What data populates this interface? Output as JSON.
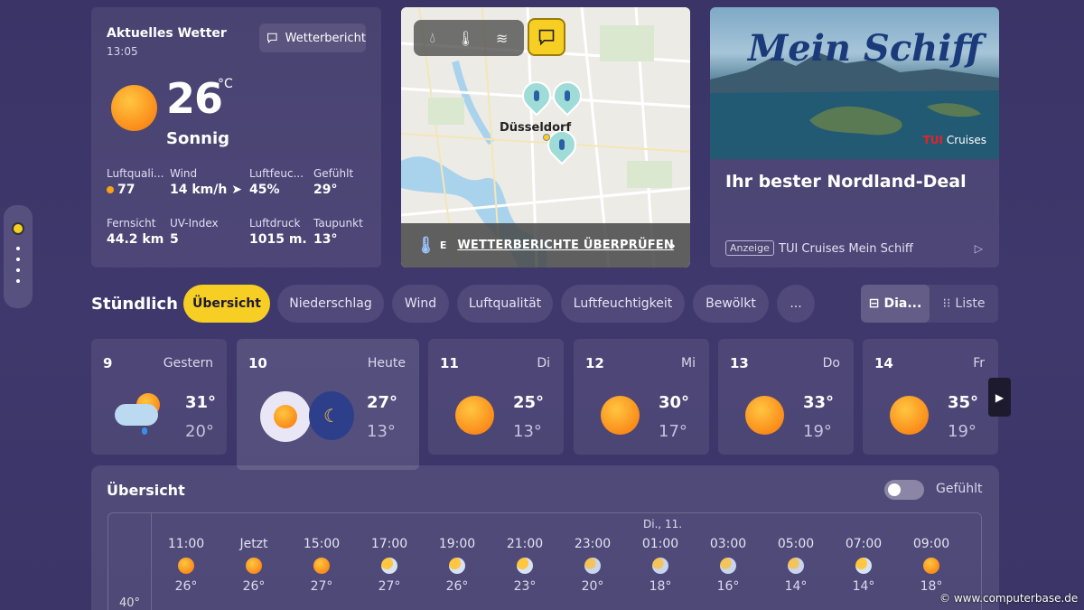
{
  "current": {
    "title": "Aktuelles Wetter",
    "time": "13:05",
    "report_btn": "Wetterbericht",
    "temp": "26",
    "unit": "°C",
    "condition": "Sonnig",
    "stats": [
      {
        "label": "Luftquali...",
        "value": "77"
      },
      {
        "label": "Wind",
        "value": "14 km/h"
      },
      {
        "label": "Luftfeuc...",
        "value": "45%"
      },
      {
        "label": "Gefühlt",
        "value": "29°"
      },
      {
        "label": "Fernsicht",
        "value": "44.2 km"
      },
      {
        "label": "UV-Index",
        "value": "5"
      },
      {
        "label": "Luftdruck",
        "value": "1015 m..."
      },
      {
        "label": "Taupunkt",
        "value": "13°"
      }
    ],
    "colors": {
      "sun": "#fb8c1a",
      "aqi_dot": "#f7a21b"
    }
  },
  "map": {
    "city": "Düsseldorf",
    "tools": [
      "drop-icon",
      "thermometer-icon",
      "wind-icon"
    ],
    "chat_icon": "chat-icon",
    "footer_prefix": "E",
    "footer_link": "WETTERBERICHTE ÜBERPRÜFEN"
  },
  "ad": {
    "brand": "Mein Schiff",
    "logo": "TUI",
    "logo_suffix": "Cruises",
    "headline": "Ihr bester Nordland-Deal",
    "tag": "Anzeige",
    "source": "TUI Cruises Mein Schiff"
  },
  "hourly": {
    "title": "Stündlich",
    "tabs": [
      "Übersicht",
      "Niederschlag",
      "Wind",
      "Luftqualität",
      "Luftfeuchtigkeit",
      "Bewölkt",
      "..."
    ],
    "view_diagram": "Dia...",
    "view_list": "Liste"
  },
  "days": [
    {
      "num": "9",
      "label": "Gestern",
      "hi": "31°",
      "lo": "20°",
      "icon": "rain-cloud-sun-icon"
    },
    {
      "num": "10",
      "label": "Heute",
      "hi": "27°",
      "lo": "13°",
      "icon": "sun-moon-icon"
    },
    {
      "num": "11",
      "label": "Di",
      "hi": "25°",
      "lo": "13°",
      "icon": "sun-icon"
    },
    {
      "num": "12",
      "label": "Mi",
      "hi": "30°",
      "lo": "17°",
      "icon": "sun-icon"
    },
    {
      "num": "13",
      "label": "Do",
      "hi": "33°",
      "lo": "19°",
      "icon": "sun-icon"
    },
    {
      "num": "14",
      "label": "Fr",
      "hi": "35°",
      "lo": "19°",
      "icon": "sun-icon"
    }
  ],
  "overview": {
    "title": "Übersicht",
    "toggle_label": "Gefühlt",
    "day_header": "Di., 11.",
    "axis_label": "40°",
    "hours": [
      {
        "time": "11:00",
        "temp": "26°",
        "icon": "sun"
      },
      {
        "time": "Jetzt",
        "temp": "26°",
        "icon": "sun"
      },
      {
        "time": "15:00",
        "temp": "27°",
        "icon": "sun"
      },
      {
        "time": "17:00",
        "temp": "27°",
        "icon": "sun-cloud"
      },
      {
        "time": "19:00",
        "temp": "26°",
        "icon": "sun-cloud"
      },
      {
        "time": "21:00",
        "temp": "23°",
        "icon": "sun-cloud"
      },
      {
        "time": "23:00",
        "temp": "20°",
        "icon": "moon-cloud"
      },
      {
        "time": "01:00",
        "temp": "18°",
        "icon": "moon-cloud"
      },
      {
        "time": "03:00",
        "temp": "16°",
        "icon": "moon-cloud"
      },
      {
        "time": "05:00",
        "temp": "14°",
        "icon": "moon-cloud"
      },
      {
        "time": "07:00",
        "temp": "14°",
        "icon": "sun-cloud"
      },
      {
        "time": "09:00",
        "temp": "18°",
        "icon": "sun"
      }
    ]
  },
  "watermark": "© www.computerbase.de"
}
